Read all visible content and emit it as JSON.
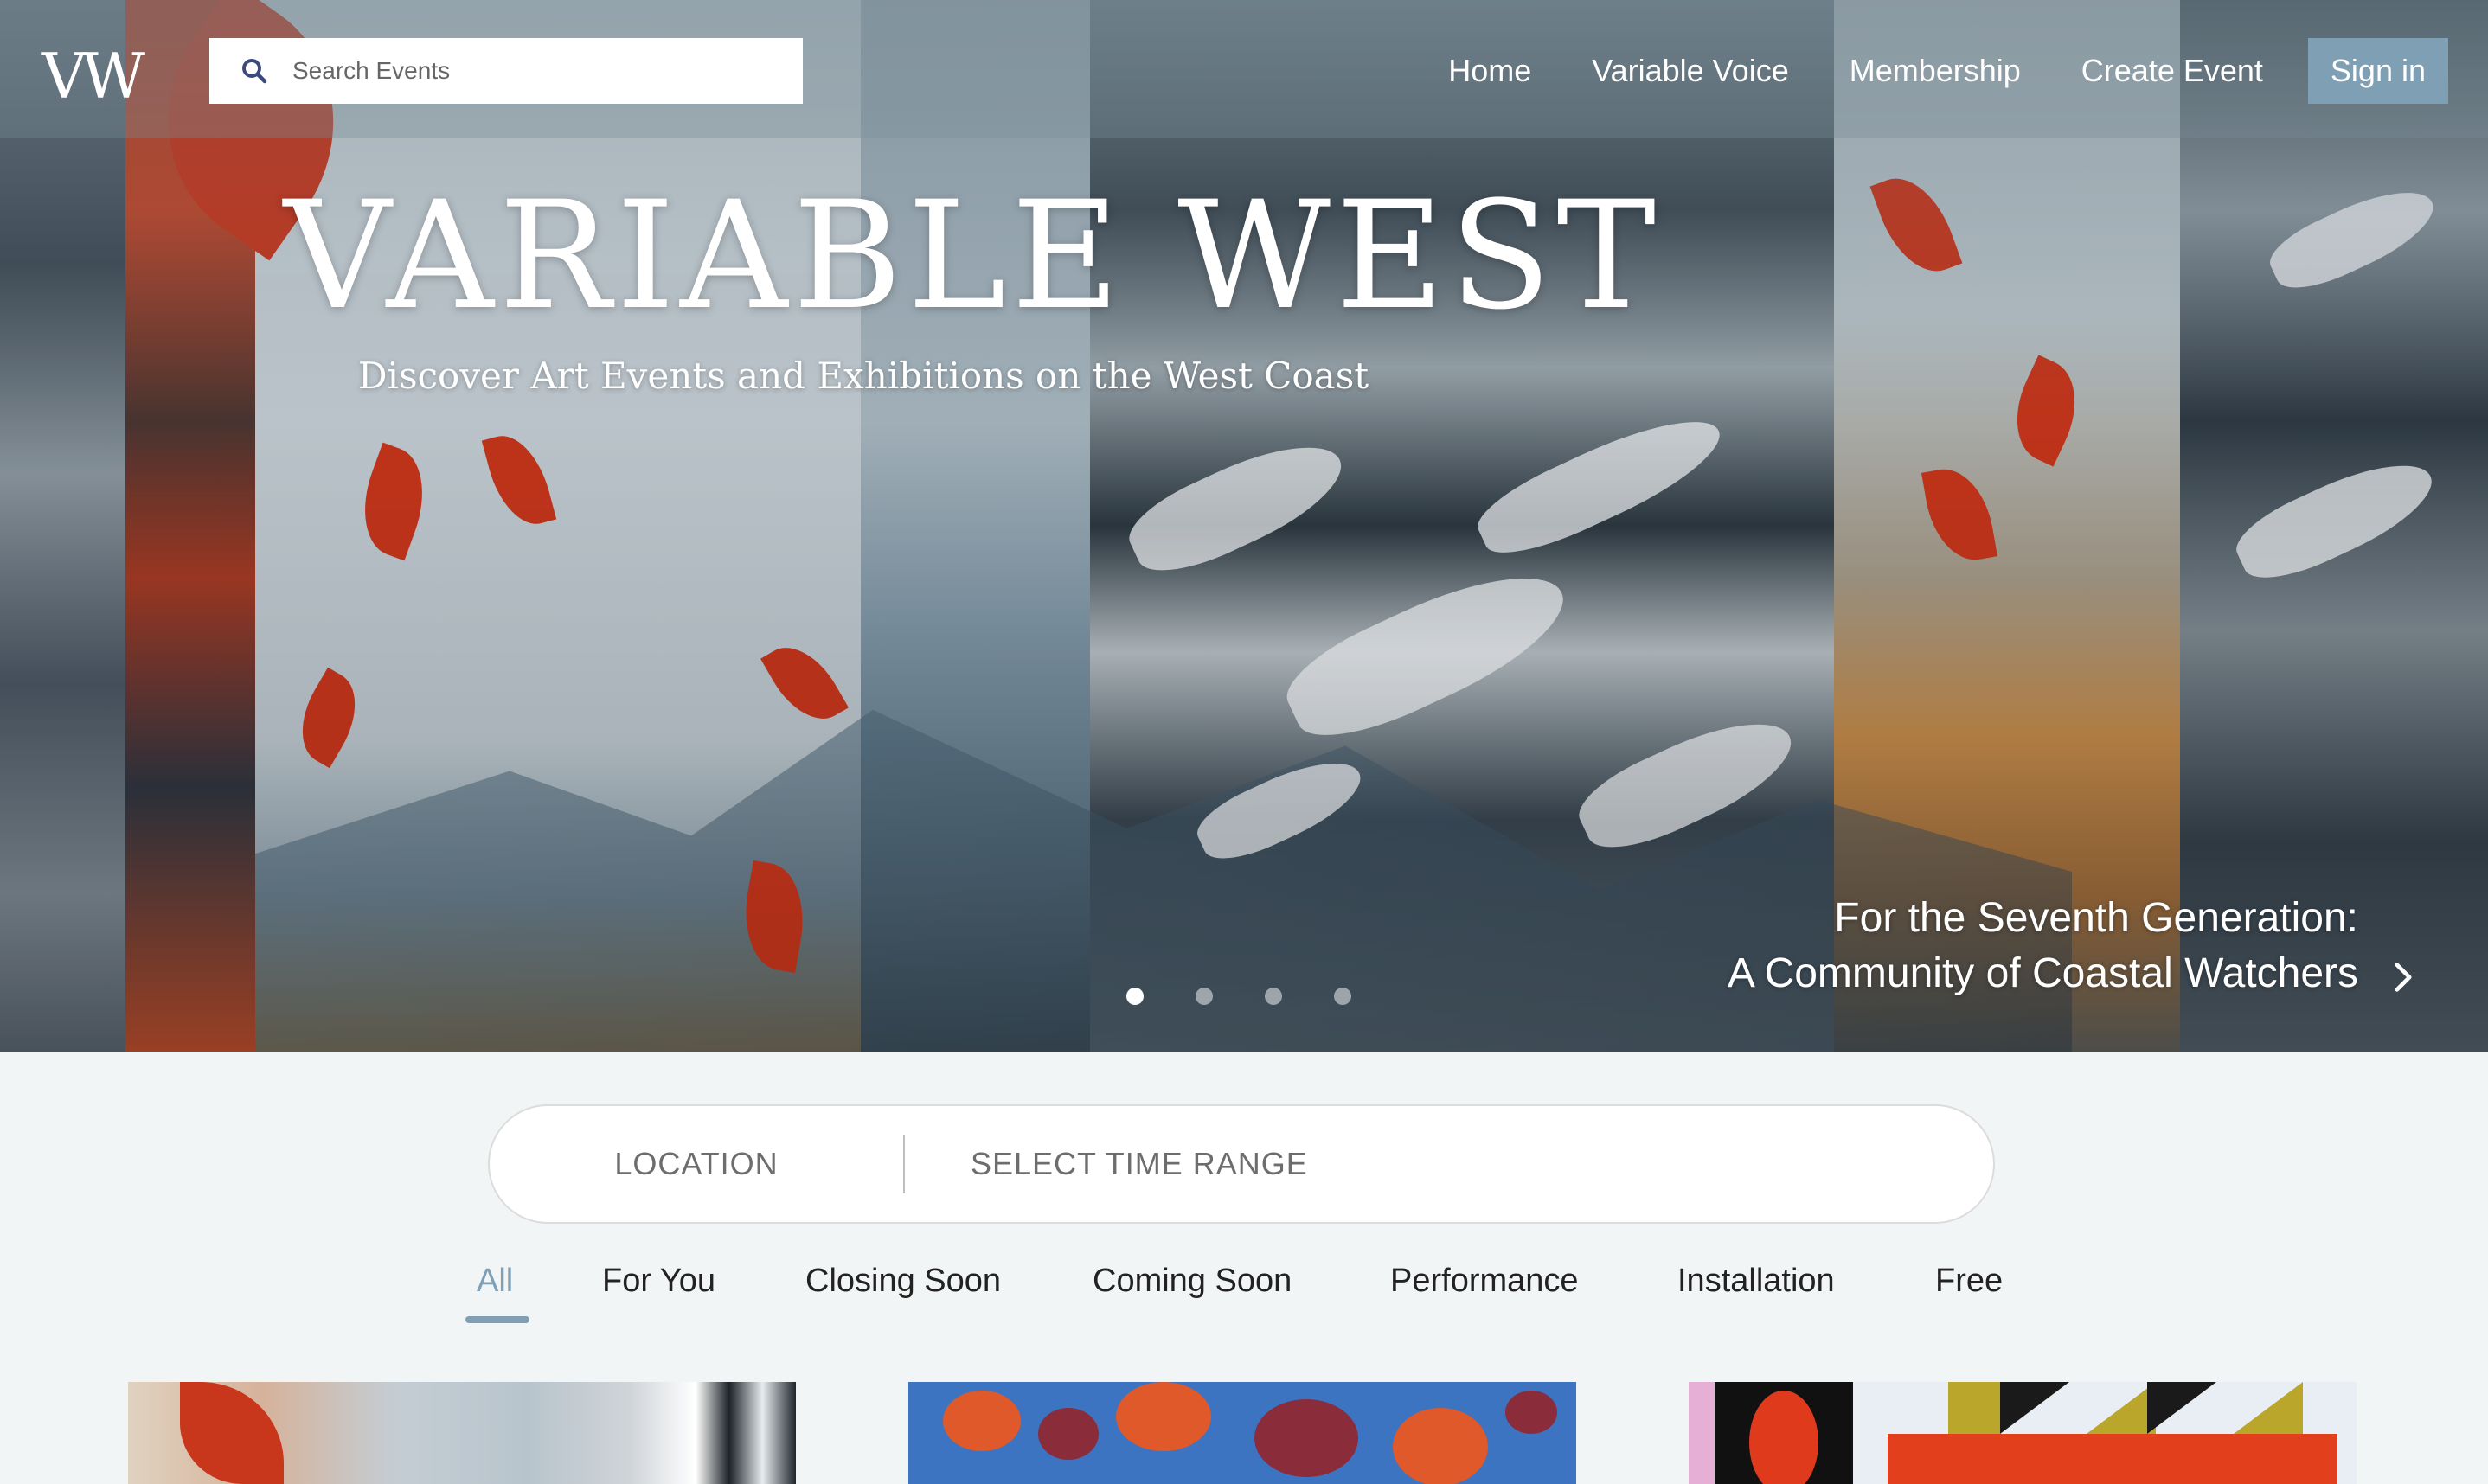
{
  "brand": {
    "logo_text": "VW",
    "accent_color": "#7fa0b4"
  },
  "search": {
    "placeholder": "Search Events",
    "icon": "search-icon"
  },
  "nav": {
    "items": [
      {
        "label": "Home"
      },
      {
        "label": "Variable Voice"
      },
      {
        "label": "Membership"
      },
      {
        "label": "Create Event"
      }
    ],
    "sign_in_label": "Sign in"
  },
  "hero": {
    "title": "VARIABLE WEST",
    "subtitle": "Discover Art Events and Exhibitions on the West Coast",
    "feature_line1": "For the Seventh Generation:",
    "feature_line2": "A Community of Coastal Watchers",
    "carousel": {
      "slide_count": 4,
      "active_index": 0
    }
  },
  "filters": {
    "location_label": "LOCATION",
    "time_label": "SELECT TIME RANGE"
  },
  "tabs": [
    {
      "label": "All",
      "active": true
    },
    {
      "label": "For You",
      "active": false
    },
    {
      "label": "Closing Soon",
      "active": false
    },
    {
      "label": "Coming Soon",
      "active": false
    },
    {
      "label": "Performance",
      "active": false
    },
    {
      "label": "Installation",
      "active": false
    },
    {
      "label": "Free",
      "active": false
    }
  ]
}
